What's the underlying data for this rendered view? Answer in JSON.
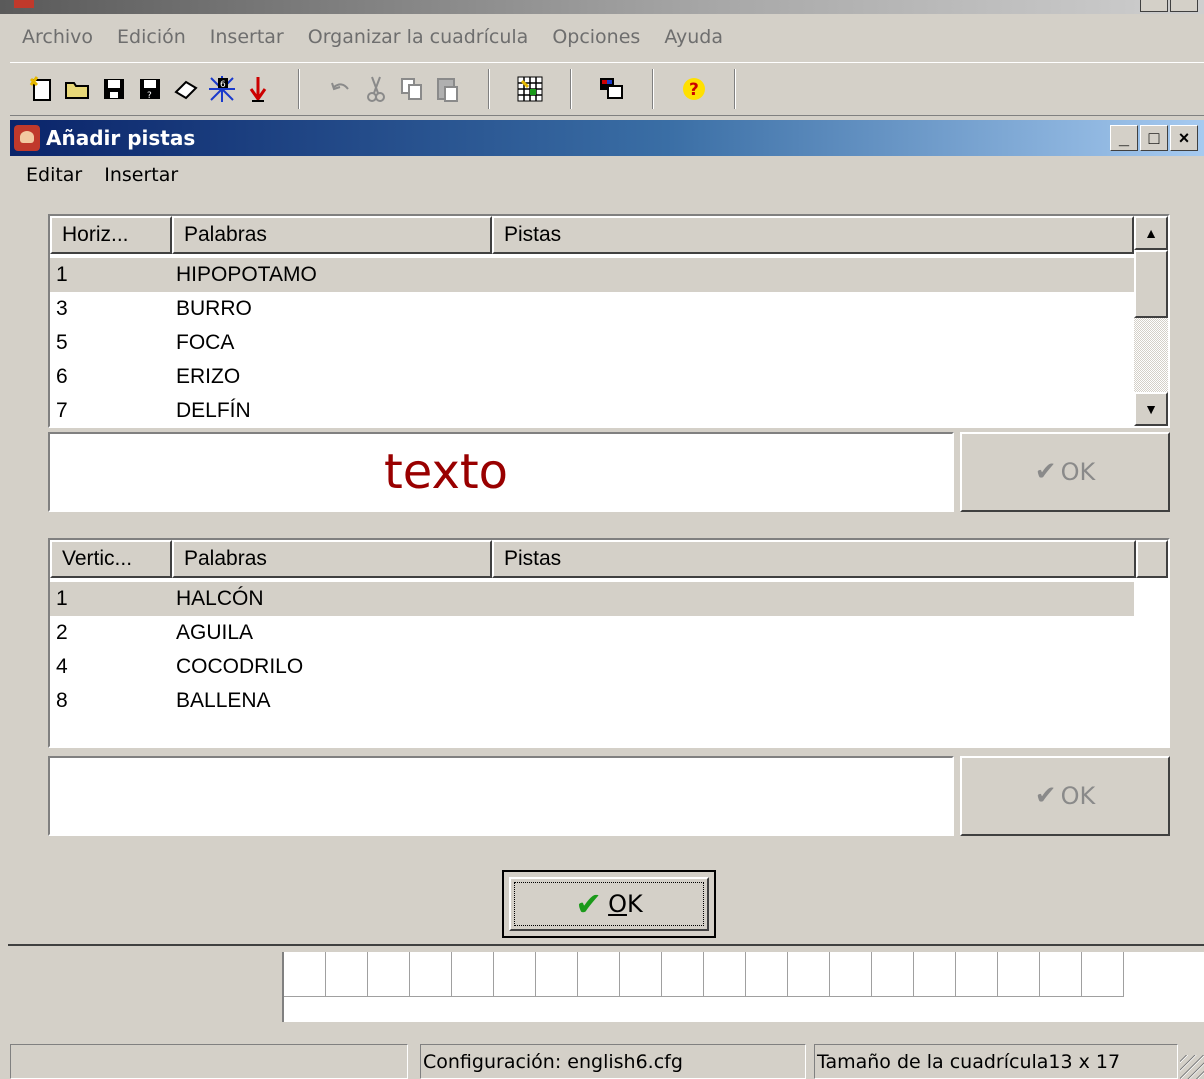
{
  "main_window": {
    "menu": [
      "Archivo",
      "Edición",
      "Insertar",
      "Organizar la cuadrícula",
      "Opciones",
      "Ayuda"
    ],
    "toolbar_icons": [
      "new-icon",
      "open-icon",
      "save-icon",
      "save-as-icon",
      "eraser-icon",
      "grid-number-icon",
      "arrow-down-icon",
      "undo-icon",
      "cut-icon",
      "copy-icon",
      "paste-icon",
      "grid-icon",
      "colors-icon",
      "help-icon"
    ]
  },
  "dialog": {
    "title": "Añadir pistas",
    "title_buttons": [
      "_",
      "□",
      "×"
    ],
    "menu": [
      "Editar",
      "Insertar"
    ],
    "horizontal": {
      "columns": [
        "Horiz...",
        "Palabras",
        "Pistas"
      ],
      "rows": [
        {
          "num": "1",
          "word": "HIPOPOTAMO",
          "clue": ""
        },
        {
          "num": "3",
          "word": "BURRO",
          "clue": ""
        },
        {
          "num": "5",
          "word": "FOCA",
          "clue": ""
        },
        {
          "num": "6",
          "word": "ERIZO",
          "clue": ""
        },
        {
          "num": "7",
          "word": "DELFÍN",
          "clue": ""
        }
      ],
      "edit_text": "texto",
      "ok_label": "OK"
    },
    "vertical": {
      "columns": [
        "Vertic...",
        "Palabras",
        "Pistas"
      ],
      "rows": [
        {
          "num": "1",
          "word": "HALCÓN",
          "clue": ""
        },
        {
          "num": "2",
          "word": "AGUILA",
          "clue": ""
        },
        {
          "num": "4",
          "word": "COCODRILO",
          "clue": ""
        },
        {
          "num": "8",
          "word": "BALLENA",
          "clue": ""
        }
      ],
      "edit_text": "",
      "ok_label": "OK"
    },
    "ok_button": {
      "mnemonic": "O",
      "rest": "K"
    }
  },
  "statusbar": {
    "pane1": "",
    "config": "Configuración: english6.cfg",
    "grid_size": "Tamaño de la cuadrícula13 x 17"
  },
  "colors": {
    "titlebar_start": "#0a246a",
    "titlebar_end": "#a6caf0",
    "edit_text": "#990000",
    "check_green": "#1a9a1a"
  }
}
